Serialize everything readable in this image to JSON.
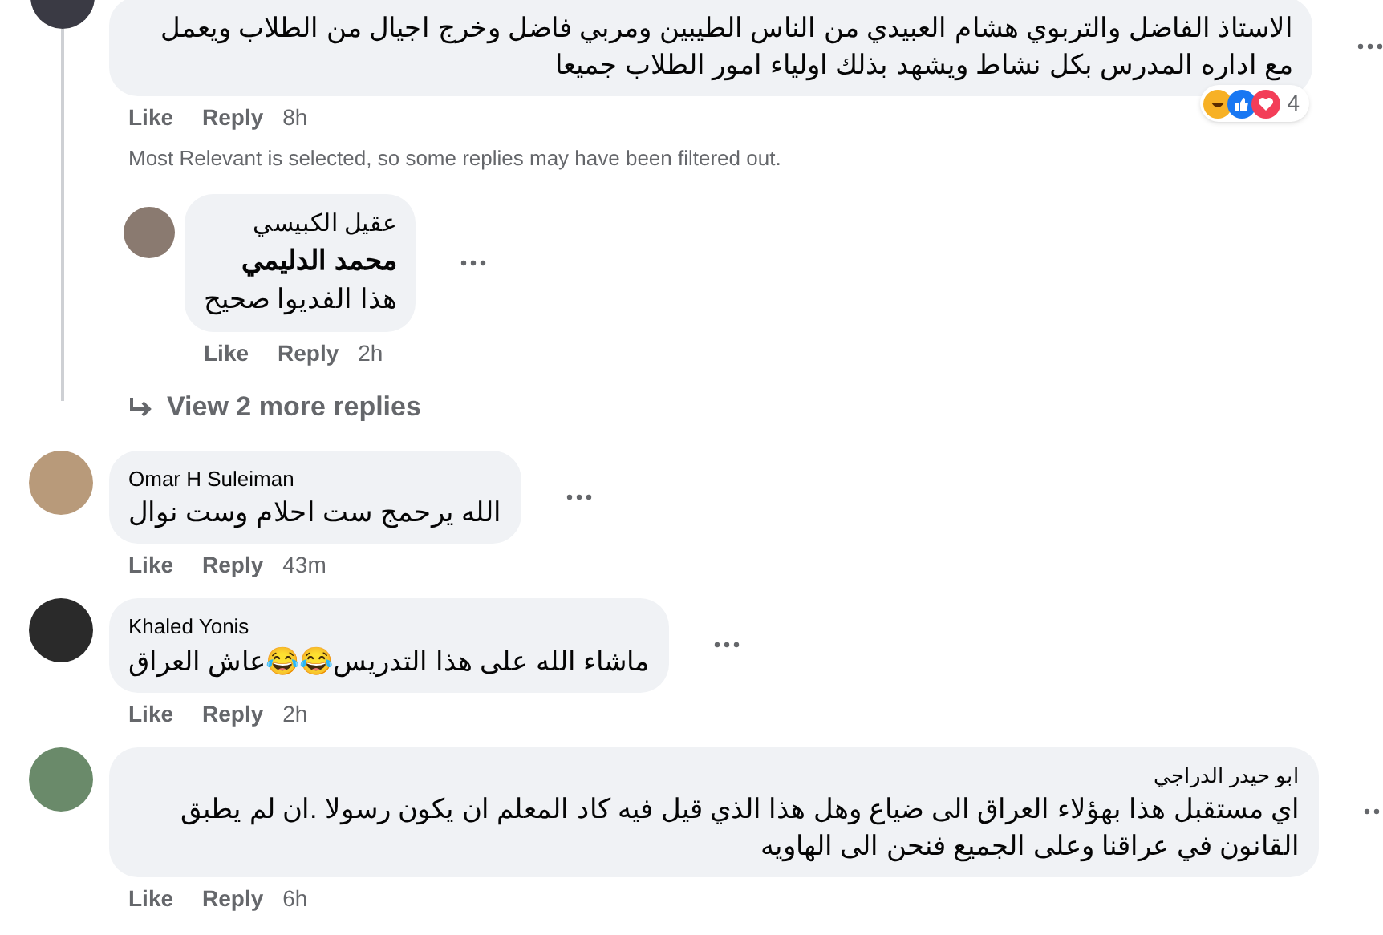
{
  "comments": [
    {
      "text": "الاستاذ الفاضل والتربوي هشام العبيدي من الناس الطيبين ومربي فاضل وخرج اجيال من الطلاب ويعمل مع اداره المدرس بكل نشاط ويشهد بذلك اولياء امور الطلاب جميعا",
      "like": "Like",
      "reply": "Reply",
      "time": "8h",
      "reaction_count": "4",
      "notice": "Most Relevant is selected, so some replies may have been filtered out.",
      "replies": [
        {
          "author": "عقيل الكبيسي",
          "mention": "محمد الدليمي",
          "text": "هذا الفديوا صحيح",
          "like": "Like",
          "reply": "Reply",
          "time": "2h"
        }
      ],
      "more_replies": "View 2 more replies"
    },
    {
      "author": "Omar H Suleiman",
      "text": "الله يرحمج ست احلام وست نوال",
      "like": "Like",
      "reply": "Reply",
      "time": "43m"
    },
    {
      "author": "Khaled Yonis",
      "text": "ماشاء الله على هذا التدريس😂😂عاش العراق",
      "like": "Like",
      "reply": "Reply",
      "time": "2h"
    },
    {
      "author": "ابو حيدر الدراجي",
      "text": "اي مستقبل هذا بهؤلاء العراق الى ضياع وهل هذا الذي قيل فيه كاد المعلم ان يكون رسولا .ان لم يطبق القانون في عراقنا وعلى الجميع فنحن الى الهاويه",
      "like": "Like",
      "reply": "Reply",
      "time": "6h"
    }
  ]
}
